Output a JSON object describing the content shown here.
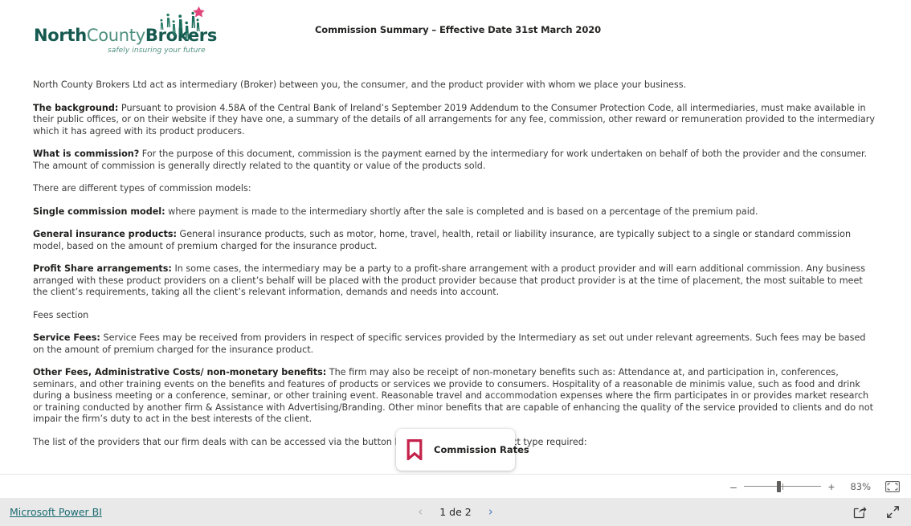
{
  "document": {
    "title": "Commission Summary  – Effective Date 31st March 2020",
    "logo": {
      "word_north": "North",
      "word_county": "County",
      "word_brokers": "Brokers",
      "tagline": "safely insuring your future",
      "figures_icon": "people-star-icon",
      "green_dark": "#15594f",
      "green_light": "#4e8f7e",
      "star_color": "#e0457b"
    },
    "paragraphs": [
      {
        "lead": "",
        "text": "North County Brokers Ltd act as intermediary (Broker) between you, the consumer, and the product provider with whom we place your business."
      },
      {
        "lead": "The background:",
        "text": " Pursuant to provision 4.58A of  the Central Bank of Ireland’s September 2019 Addendum to the Consumer Protection Code, all intermediaries, must make available in their public offices, or on their website if they have one, a summary of the details of all arrangements for any fee, commission, other reward or remuneration provided to the intermediary which it has agreed with its product producers."
      },
      {
        "lead": "What is commission?",
        "text": " For the purpose of this document, commission is the payment earned by the intermediary for work undertaken on behalf of both the provider and the consumer.   The amount of commission is generally directly related to the quantity or value of the products sold."
      },
      {
        "lead": "",
        "text": "There are different types of commission models:"
      },
      {
        "lead": "Single commission model:",
        "text": " where payment is made to the intermediary shortly after the sale is completed and is based on a percentage of the premium paid."
      },
      {
        "lead": "General insurance products:",
        "text": " General insurance products, such as motor, home, travel, health, retail or liability insurance, are typically subject to a single or standard commission model, based on the amount of premium charged for the insurance product."
      },
      {
        "lead": "Profit Share arrangements:",
        "text": " In some cases, the intermediary may be a party to a profit-share arrangement with a product provider and will earn additional commission.  Any business arranged with these product providers on a client’s behalf will be placed with the product provider because that product provider is at the time of placement, the most suitable to meet the client’s requirements, taking all the client’s relevant information, demands and needs into account."
      },
      {
        "lead": "",
        "text": "Fees section"
      },
      {
        "lead": "Service Fees:",
        "text": " Service Fees may be received from providers in respect of specific services provided by the Intermediary as set out under relevant agreements. Such fees may be based on the amount of premium charged for the insurance product."
      },
      {
        "lead": "Other Fees, Administrative Costs/ non-monetary benefits:",
        "text": " The firm may also be receipt of non-monetary benefits such as: Attendance at, and participation in, conferences, seminars, and other training events on the benefits and features of products or services we provide to consumers.  Hospitality of a reasonable de minimis value, such as food and drink during a business meeting or a conference, seminar, or other training event. Reasonable travel and accommodation expenses where the firm participates in or provides market research or training conducted by another firm & Assistance with Advertising/Branding. Other minor benefits that are capable of enhancing the quality of the service provided to clients and do not impair the firm’s duty to act in the best interests of the client."
      },
      {
        "lead": "",
        "text": "The list of the providers that our firm deals with can be accessed via the button below based on the product type required:"
      }
    ],
    "commission_rates_button": {
      "label": "Commission Rates",
      "icon": "bookmark-icon",
      "icon_color": "#c4214b"
    }
  },
  "zoom_bar": {
    "zoom_out_label": "–",
    "zoom_in_label": "+",
    "zoom_level": "83%",
    "fit_icon": "fit-to-page-icon"
  },
  "footer": {
    "powerbi_label": "Microsoft Power BI",
    "powerbi_color": "#1b6b72",
    "pager": {
      "prev_label": "‹",
      "page_label": "1 de 2",
      "next_label": "›"
    },
    "actions": {
      "share_icon": "share-icon",
      "fullscreen_icon": "fullscreen-icon"
    }
  }
}
